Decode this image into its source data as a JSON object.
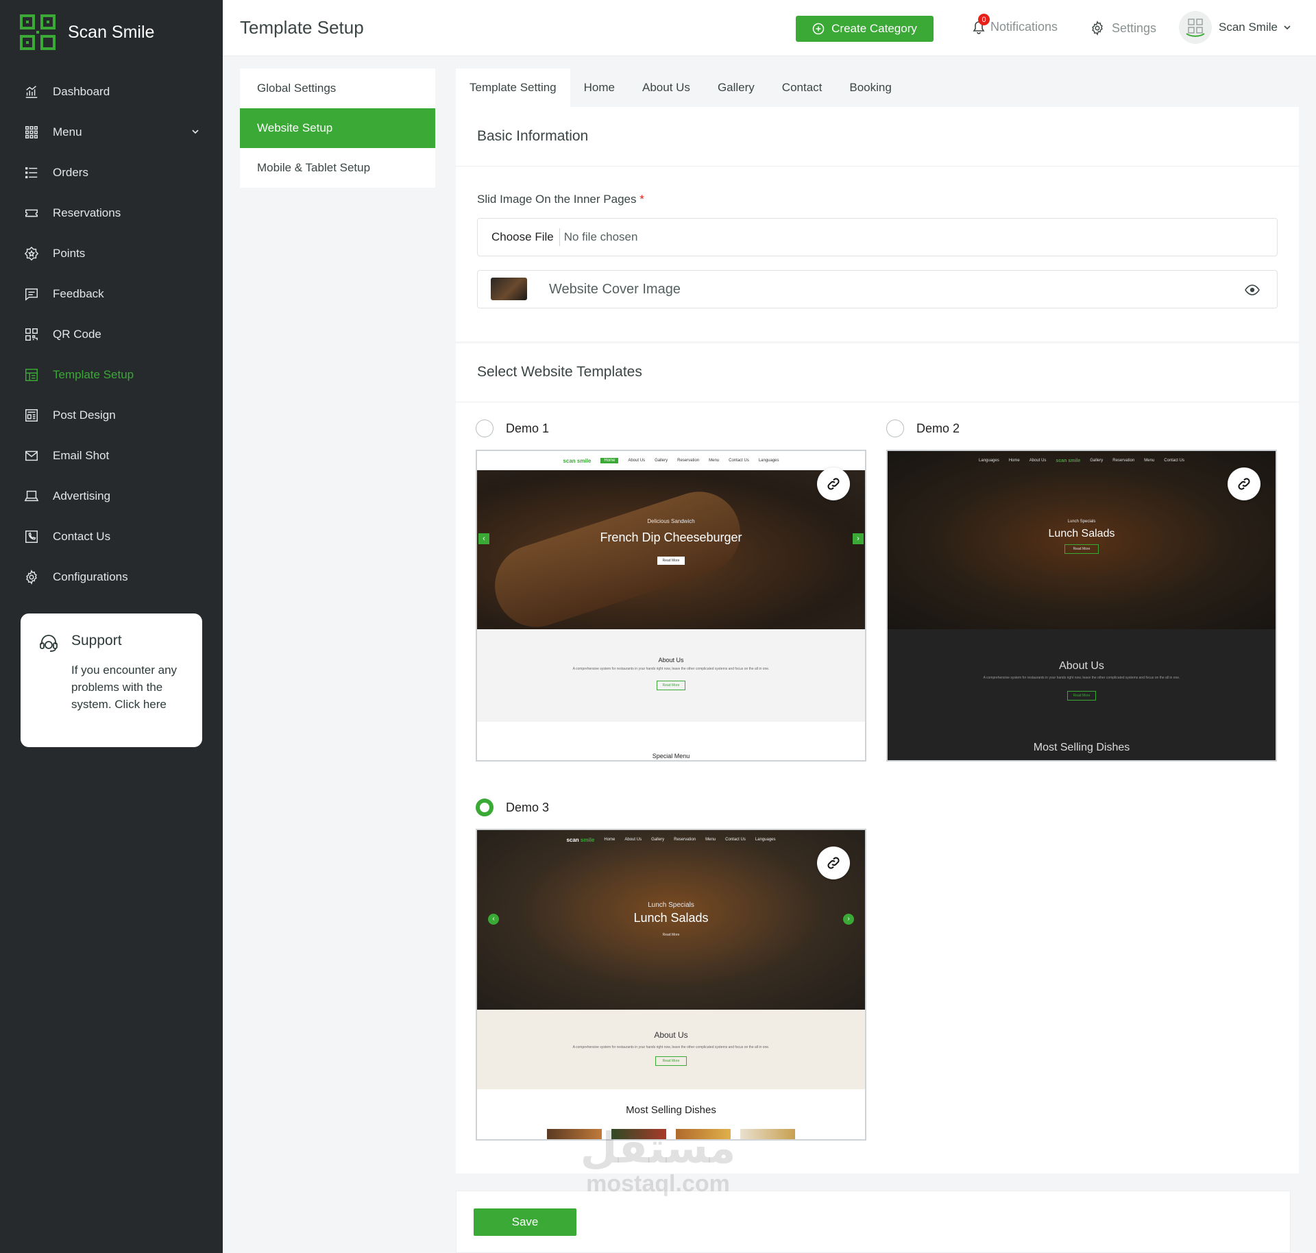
{
  "brand": {
    "name": "Scan Smile"
  },
  "sidebar": {
    "items": [
      {
        "label": "Dashboard",
        "icon": "chart-bars-icon"
      },
      {
        "label": "Menu",
        "icon": "grid-icon"
      },
      {
        "label": "Orders",
        "icon": "list-icon"
      },
      {
        "label": "Reservations",
        "icon": "ticket-icon"
      },
      {
        "label": "Points",
        "icon": "star-badge-icon"
      },
      {
        "label": "Feedback",
        "icon": "message-icon"
      },
      {
        "label": "QR Code",
        "icon": "qr-icon"
      },
      {
        "label": "Template Setup",
        "icon": "layout-icon"
      },
      {
        "label": "Post Design",
        "icon": "newspaper-icon"
      },
      {
        "label": "Email Shot",
        "icon": "mail-icon"
      },
      {
        "label": "Advertising",
        "icon": "laptop-icon"
      },
      {
        "label": "Contact Us",
        "icon": "phone-icon"
      },
      {
        "label": "Configurations",
        "icon": "gear-icon"
      }
    ],
    "active": "Template Setup",
    "support": {
      "title": "Support",
      "text": "If you encounter any problems with the system. Click here"
    }
  },
  "header": {
    "title": "Template Setup",
    "create_label": "Create Category",
    "notifications_label": "Notifications",
    "notifications_count": "0",
    "settings_label": "Settings",
    "user_name": "Scan Smile"
  },
  "subnav": {
    "items": [
      {
        "label": "Global Settings"
      },
      {
        "label": "Website Setup"
      },
      {
        "label": "Mobile & Tablet Setup"
      }
    ],
    "active": "Website Setup"
  },
  "tabs": [
    {
      "label": "Template Setting"
    },
    {
      "label": "Home"
    },
    {
      "label": "About Us"
    },
    {
      "label": "Gallery"
    },
    {
      "label": "Contact"
    },
    {
      "label": "Booking"
    }
  ],
  "active_tab": "Template Setting",
  "basic": {
    "title": "Basic Information",
    "slide_label": "Slid Image On the Inner Pages",
    "required_mark": "*",
    "file_button": "Choose File",
    "file_status": "No file chosen",
    "cover_label": "Website Cover Image"
  },
  "templates": {
    "title": "Select Website Templates",
    "selected": "Demo 3",
    "demos": [
      {
        "label": "Demo 1",
        "brand_top": "scan",
        "brand_bottom": "smile",
        "nav": [
          "Home",
          "About Us",
          "Gallery",
          "Reservation",
          "Menu",
          "Contact Us"
        ],
        "languages": "Languages",
        "hero_sub": "Delicious Sandwich",
        "hero_title": "French Dip Cheeseburger",
        "read_more": "Read More",
        "about_title": "About Us",
        "about_text": "A comprehensive system for restaurants in your hands right now, leave the other complicated systems and focus on the all in one.",
        "section2": "Special Menu"
      },
      {
        "label": "Demo 2",
        "brand_top": "scan",
        "brand_bottom": "smile",
        "nav": [
          "Home",
          "About Us",
          "Gallery",
          "Reservation",
          "Menu",
          "Contact Us"
        ],
        "languages": "Languages",
        "hero_sub": "Lunch Specials",
        "hero_title": "Lunch Salads",
        "read_more": "Read More",
        "about_title": "About Us",
        "about_text": "A comprehensive system for restaurants in your hands right now, leave the other complicated systems and focus on the all in one.",
        "section2": "Most Selling Dishes"
      },
      {
        "label": "Demo 3",
        "brand_top": "scan",
        "brand_bottom": "smile",
        "nav": [
          "Home",
          "About Us",
          "Gallery",
          "Reservation",
          "Menu",
          "Contact Us"
        ],
        "languages": "Languages",
        "hero_sub": "Lunch Specials",
        "hero_title": "Lunch Salads",
        "read_more": "Read More",
        "about_title": "About Us",
        "about_text": "A comprehensive system for restaurants in your hands right now, leave the other complicated systems and focus on the all in one.",
        "section2": "Most Selling Dishes"
      }
    ]
  },
  "save_label": "Save",
  "watermark": {
    "arabic": "مستقل",
    "latin": "mostaql.com"
  },
  "colors": {
    "accent": "#3aa935",
    "sidebar": "#262a2c",
    "badge": "#e8201a"
  }
}
